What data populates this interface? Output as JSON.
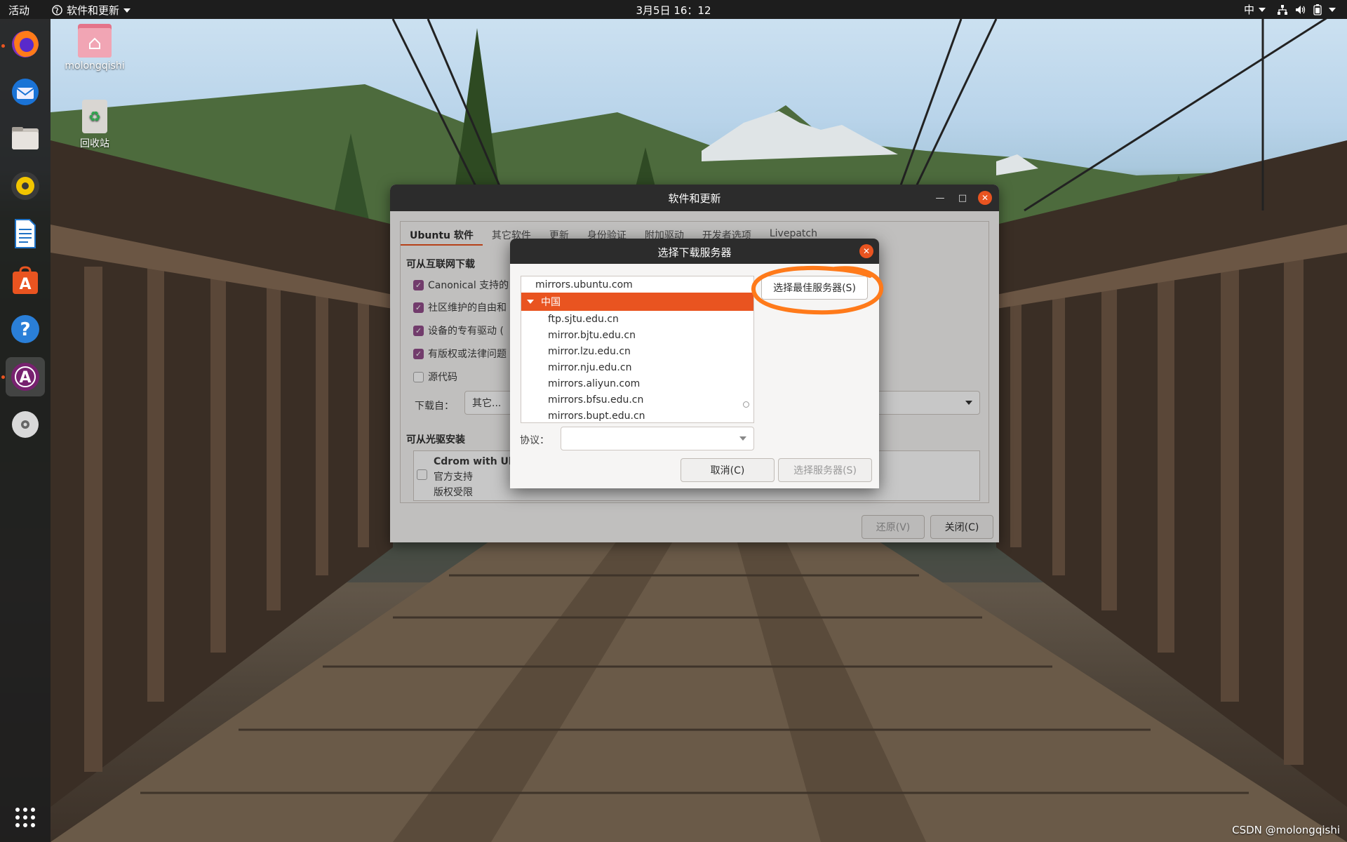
{
  "topbar": {
    "activities": "活动",
    "app_menu": "软件和更新",
    "clock": "3月5日  16：12",
    "input_method": "中"
  },
  "dock": {
    "items": [
      "firefox-icon",
      "thunderbird-icon",
      "files-icon",
      "rhythmbox-icon",
      "libreoffice-writer-icon",
      "ubuntu-software-icon",
      "help-icon",
      "software-updater-icon",
      "dvd-icon",
      "show-apps-icon"
    ]
  },
  "desktop": {
    "home_label": "molongqishi",
    "trash_label": "回收站"
  },
  "mainwin": {
    "title": "软件和更新",
    "tabs": [
      "Ubuntu 软件",
      "其它软件",
      "更新",
      "身份验证",
      "附加驱动",
      "开发者选项",
      "Livepatch"
    ],
    "internet_section": "可从互联网下载",
    "checks": [
      {
        "label": "Canonical 支持的",
        "checked": true
      },
      {
        "label": "社区维护的自由和",
        "checked": true
      },
      {
        "label": "设备的专有驱动 (",
        "checked": true
      },
      {
        "label": "有版权或法律问题",
        "checked": true
      },
      {
        "label": "源代码",
        "checked": false
      }
    ],
    "download_from_label": "下载自：",
    "download_from_value": "其它...",
    "cdrom_section": "可从光驱安装",
    "cdrom_title": "Cdrom with Ub",
    "cdrom_line2": "官方支持",
    "cdrom_line3": "版权受限",
    "revert_label": "还原(V)",
    "close_label": "关闭(C)"
  },
  "dialog": {
    "title": "选择下载服务器",
    "servers": {
      "top": "mirrors.ubuntu.com",
      "group": "中国",
      "children": [
        "ftp.sjtu.edu.cn",
        "mirror.bjtu.edu.cn",
        "mirror.lzu.edu.cn",
        "mirror.nju.edu.cn",
        "mirrors.aliyun.com",
        "mirrors.bfsu.edu.cn",
        "mirrors.bupt.edu.cn"
      ]
    },
    "best_server_label": "选择最佳服务器(S)",
    "protocol_label": "协议：",
    "protocol_value": "",
    "cancel_label": "取消(C)",
    "choose_label": "选择服务器(S)"
  },
  "watermark": "CSDN @molongqishi",
  "colors": {
    "accent": "#e95420",
    "annotation": "#ff7a1a",
    "checkbox": "#924d8b"
  }
}
